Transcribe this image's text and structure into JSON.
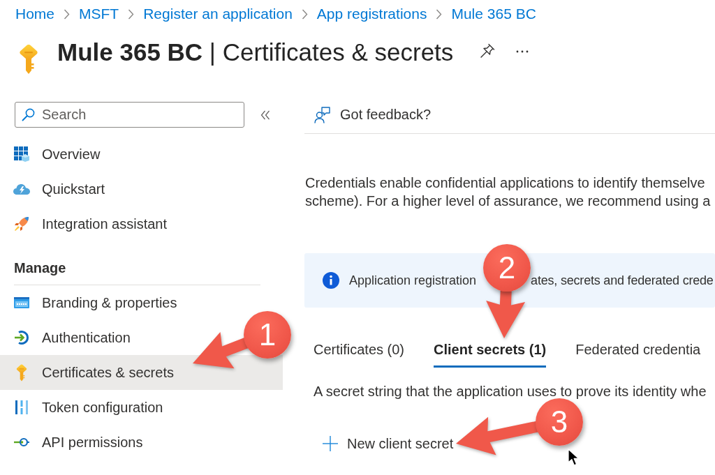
{
  "breadcrumb": [
    {
      "label": "Home"
    },
    {
      "label": "MSFT"
    },
    {
      "label": "Register an application"
    },
    {
      "label": "App registrations"
    },
    {
      "label": "Mule 365 BC"
    }
  ],
  "title": "**Mule 365 BC** | Certificates & secrets",
  "sidebar": {
    "search": {
      "placeholder": "Search"
    },
    "groups": [
      {
        "items": [
          {
            "label": "Overview",
            "selected": false
          },
          {
            "label": "Quickstart",
            "selected": false
          },
          {
            "label": "Integration assistant",
            "selected": false
          }
        ]
      },
      {
        "heading": "Manage",
        "items": [
          {
            "label": "Branding & properties",
            "selected": false
          },
          {
            "label": "Authentication",
            "selected": false
          },
          {
            "label": "Certificates & secrets",
            "selected": true
          },
          {
            "label": "Token configuration",
            "selected": false
          },
          {
            "label": "API permissions",
            "selected": false
          }
        ]
      }
    ]
  },
  "feedback_button": {
    "label": "Got feedback?"
  },
  "description": {
    "lines": [
      "Credentials enable confidential applications to identify themselve",
      "scheme). For a higher level of assurance, we recommend using a"
    ]
  },
  "info_banner": {
    "text_before": "Application registration",
    "text_after": "ates, secrets and federated crede"
  },
  "tabs": [
    {
      "label": "Certificates (0)",
      "selected": false
    },
    {
      "label": "Client secrets (1)",
      "selected": true
    },
    {
      "label": "Federated credentia",
      "selected": false
    }
  ],
  "tab_description": "A secret string that the application uses to prove its identity whe",
  "new_secret_button": {
    "label": "New client secret"
  },
  "callouts": [
    {
      "number": "1"
    },
    {
      "number": "2"
    },
    {
      "number": "3"
    }
  ]
}
